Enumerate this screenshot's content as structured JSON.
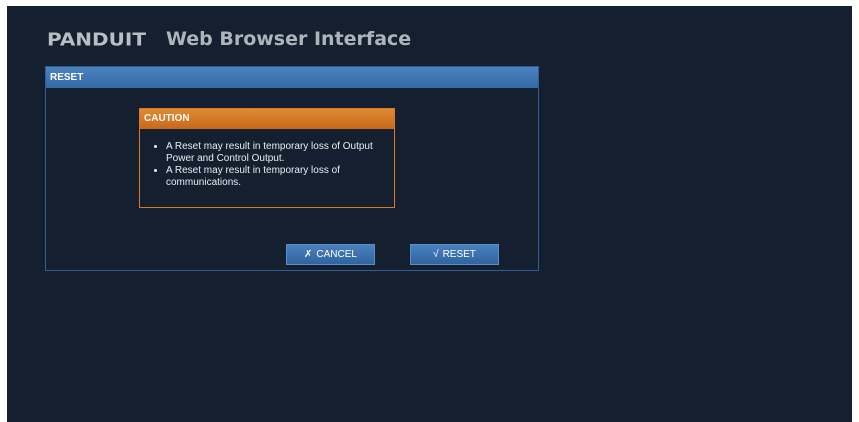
{
  "header": {
    "logo_text": "PANDUIT",
    "title": "Web Browser Interface"
  },
  "panel": {
    "title": "RESET"
  },
  "caution": {
    "title": "CAUTION",
    "items": [
      "A Reset may result in temporary loss of Output Power and Control Output.",
      "A Reset may result in temporary loss of communications."
    ]
  },
  "buttons": {
    "cancel_glyph": "✗",
    "cancel_label": "CANCEL",
    "reset_glyph": "√",
    "reset_label": "RESET"
  },
  "colors": {
    "background": "#14202f",
    "panel_header": "#3a72b0",
    "caution_header": "#d9782a"
  }
}
